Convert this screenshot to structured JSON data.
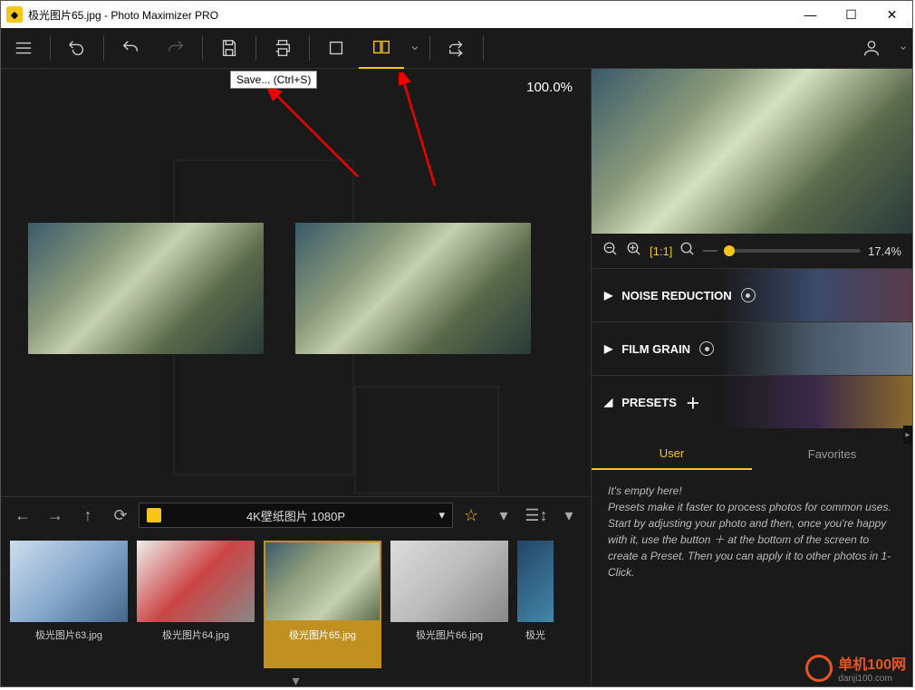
{
  "title": "极光图片65.jpg - Photo Maximizer PRO",
  "tooltip": "Save... (Ctrl+S)",
  "viewer": {
    "zoom": "100.0%"
  },
  "right_preview": {
    "zoom_pct": "17.4%"
  },
  "panels": {
    "noise": "NOISE REDUCTION",
    "film": "FILM GRAIN",
    "presets": "PRESETS"
  },
  "preset_tabs": {
    "user": "User",
    "favorites": "Favorites"
  },
  "preset_text": {
    "line1": "It's empty here!",
    "line2": "Presets make it faster to process photos for common uses. Start by adjusting your photo and then, once you're happy with it, use the button ＋ at the bottom of the screen to create a Preset. Then you can apply it to other photos in 1-Click."
  },
  "browser": {
    "path": "4K壁纸图片 1080P",
    "thumbs": [
      {
        "label": "极光图片63.jpg"
      },
      {
        "label": "极光图片64.jpg"
      },
      {
        "label": "极光图片65.jpg"
      },
      {
        "label": "极光图片66.jpg"
      },
      {
        "label": "极光"
      }
    ]
  },
  "watermark": {
    "t1": "单机100网",
    "t2": "danji100.com"
  }
}
